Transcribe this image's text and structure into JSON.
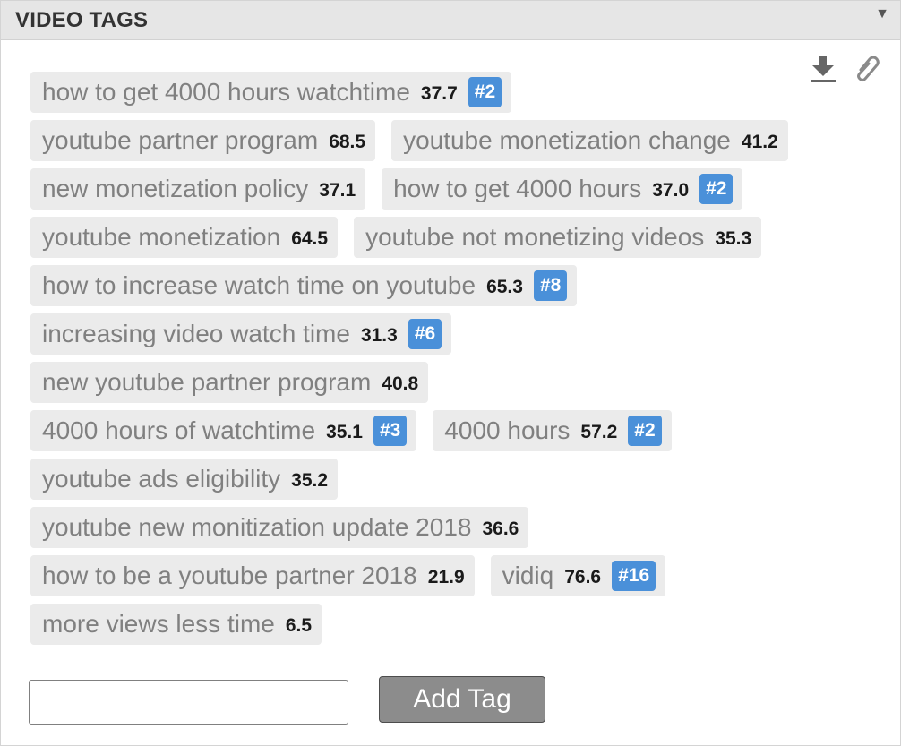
{
  "panel": {
    "title": "VIDEO TAGS",
    "collapse_glyph": "▼",
    "icons": [
      "download-icon",
      "paperclip-icon"
    ]
  },
  "tags": [
    {
      "text": "how to get 4000 hours watchtime",
      "score": "37.7",
      "rank": "#2"
    },
    {
      "text": "youtube partner program",
      "score": "68.5",
      "rank": ""
    },
    {
      "text": "youtube monetization change",
      "score": "41.2",
      "rank": ""
    },
    {
      "text": "new monetization policy",
      "score": "37.1",
      "rank": ""
    },
    {
      "text": "how to get 4000 hours",
      "score": "37.0",
      "rank": "#2"
    },
    {
      "text": "youtube monetization",
      "score": "64.5",
      "rank": ""
    },
    {
      "text": "youtube not monetizing videos",
      "score": "35.3",
      "rank": ""
    },
    {
      "text": "how to increase watch time on youtube",
      "score": "65.3",
      "rank": "#8"
    },
    {
      "text": "increasing video watch time",
      "score": "31.3",
      "rank": "#6"
    },
    {
      "text": "new youtube partner program",
      "score": "40.8",
      "rank": ""
    },
    {
      "text": "4000 hours of watchtime",
      "score": "35.1",
      "rank": "#3"
    },
    {
      "text": "4000 hours",
      "score": "57.2",
      "rank": "#2"
    },
    {
      "text": "youtube ads eligibility",
      "score": "35.2",
      "rank": ""
    },
    {
      "text": "youtube new monitization update 2018",
      "score": "36.6",
      "rank": ""
    },
    {
      "text": "how to be a youtube partner 2018",
      "score": "21.9",
      "rank": ""
    },
    {
      "text": "vidiq",
      "score": "76.6",
      "rank": "#16"
    },
    {
      "text": "more views less time",
      "score": "6.5",
      "rank": ""
    }
  ],
  "add_tag": {
    "input_value": "",
    "placeholder": "",
    "button_label": "Add Tag"
  },
  "colors": {
    "header_bg": "#e6e6e6",
    "tag_bg": "#ebebeb",
    "rank_badge": "#4a90d9",
    "button_bg": "#8c8c8c"
  }
}
